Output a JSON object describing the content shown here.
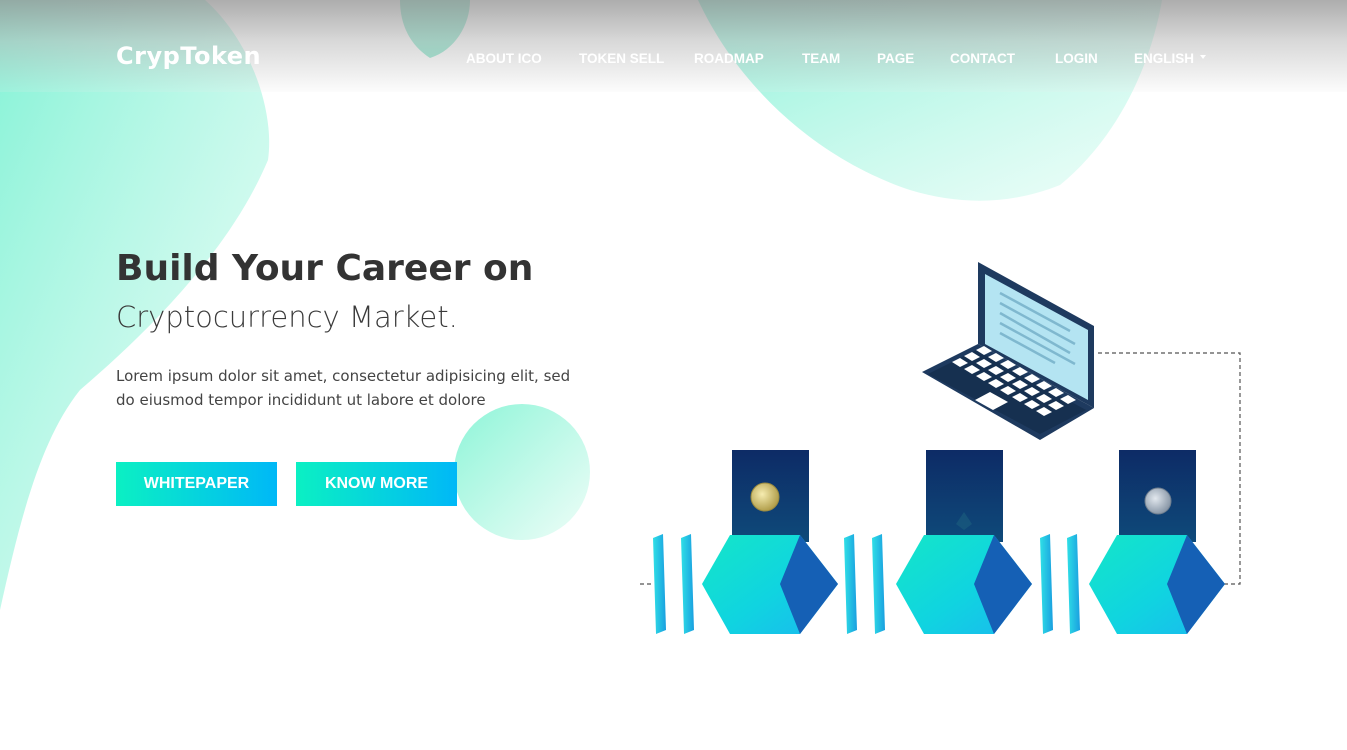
{
  "header": {
    "logo": "CrypToken",
    "nav": [
      {
        "label": "ABOUT ICO"
      },
      {
        "label": "TOKEN SELL"
      },
      {
        "label": "ROADMAP"
      },
      {
        "label": "TEAM"
      },
      {
        "label": "PAGE"
      },
      {
        "label": "CONTACT"
      },
      {
        "label": "LOGIN"
      },
      {
        "label": "ENGLISH",
        "icon": "caret-down-icon"
      }
    ]
  },
  "hero": {
    "title": "Build Your Career on",
    "subtitle": "Cryptocurrency Market.",
    "text": "Lorem ipsum dolor sit amet, consectetur adipisicing elit, sed do eiusmod tempor incididunt ut labore et dolore",
    "buttons": {
      "whitepaper": "WHITEPAPER",
      "know_more": "KNOW MORE"
    }
  },
  "colors": {
    "accent_start": "#0bf0c3",
    "accent_end": "#00b8f7",
    "heading": "#333333",
    "block_dark": "#0f5fb3",
    "laptop": "#1e3a5f"
  },
  "illustration": {
    "icons": [
      "laptop-icon",
      "bitcoin-coin-icon",
      "ethereum-coin-icon",
      "litecoin-coin-icon",
      "blockchain-block-icon"
    ]
  }
}
